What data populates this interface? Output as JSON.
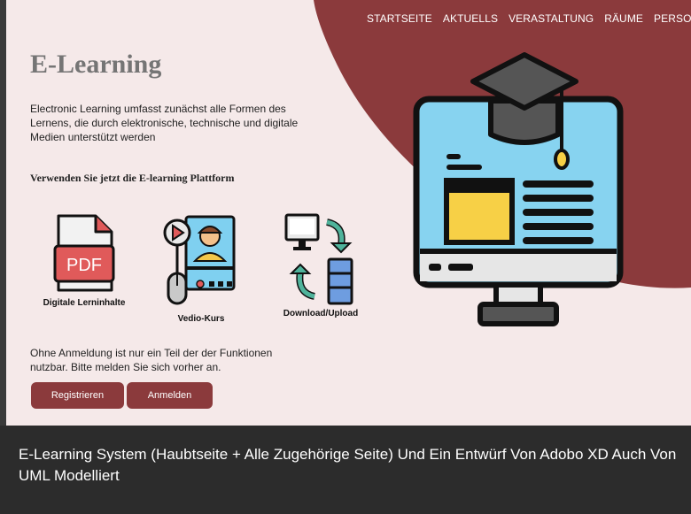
{
  "nav": {
    "items": [
      {
        "label": "STARTSEITE"
      },
      {
        "label": "AKTUELLS"
      },
      {
        "label": "VERASTALTUNG"
      },
      {
        "label": "RÄUME"
      },
      {
        "label": "PERSONEN"
      }
    ]
  },
  "hero": {
    "title": "E-Learning",
    "intro": "Electronic Learning umfasst zunächst alle Formen des Lernens, die durch elektronische, technische und digitale Medien unterstützt werden",
    "use_heading": "Verwenden Sie jetzt die E-learning Plattform"
  },
  "features": [
    {
      "label": "Digitale Lerninhalte",
      "icon": "pdf-document-icon",
      "icon_text": "PDF"
    },
    {
      "label": "Vedio-Kurs",
      "icon": "video-course-icon"
    },
    {
      "label": "Download/Upload",
      "icon": "download-upload-icon"
    }
  ],
  "note": "Ohne Anmeldung ist nur ein Teil der der Funktionen nutzbar. Bitte melden Sie sich vorher an.",
  "buttons": {
    "register": "Registrieren",
    "login": "Anmelden"
  },
  "illustration": {
    "icon": "monitor-graduation-cap-icon"
  },
  "caption": "E-Learning System (Haubtseite + Alle Zugehörige Seite) Und Ein Entwürf Von Adobo XD Auch Von UML Modelliert",
  "colors": {
    "accent": "#8b3a3c",
    "page_bg": "#f5e9e9",
    "footer_bg": "#2c2c2c"
  }
}
